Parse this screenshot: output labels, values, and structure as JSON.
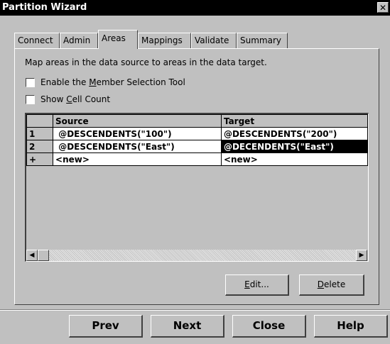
{
  "window": {
    "title": "Partition Wizard",
    "close_glyph": "✕"
  },
  "tabs": [
    {
      "label": "Connect"
    },
    {
      "label": "Admin"
    },
    {
      "label": "Areas",
      "active": true
    },
    {
      "label": "Mappings"
    },
    {
      "label": "Validate"
    },
    {
      "label": "Summary"
    }
  ],
  "panel": {
    "description": "Map areas in the data source to areas in the data target.",
    "enable_member_tool": {
      "pre": "Enable the ",
      "accel": "M",
      "post": "ember Selection Tool",
      "checked": false
    },
    "show_cell_count": {
      "pre": "Show ",
      "accel": "C",
      "post": "ell Count",
      "checked": false
    }
  },
  "grid": {
    "columns": {
      "source": "Source",
      "target": "Target"
    },
    "rows": [
      {
        "num": "1",
        "source": " @DESCENDENTS(\"100\")",
        "target": "@DESCENDENTS(\"200\")"
      },
      {
        "num": "2",
        "source": " @DESCENDENTS(\"East\")",
        "target": "@DECENDENTS(\"East\")",
        "selected_cell": "target"
      },
      {
        "num": "+",
        "source": "<new>",
        "target": "<new>"
      }
    ],
    "scroll_left_glyph": "◀",
    "scroll_right_glyph": "▶"
  },
  "buttons": {
    "edit": {
      "accel": "E",
      "rest": "dit..."
    },
    "delete": {
      "accel": "D",
      "rest": "elete"
    },
    "prev": "Prev",
    "next": "Next",
    "close": "Close",
    "help": "Help"
  }
}
